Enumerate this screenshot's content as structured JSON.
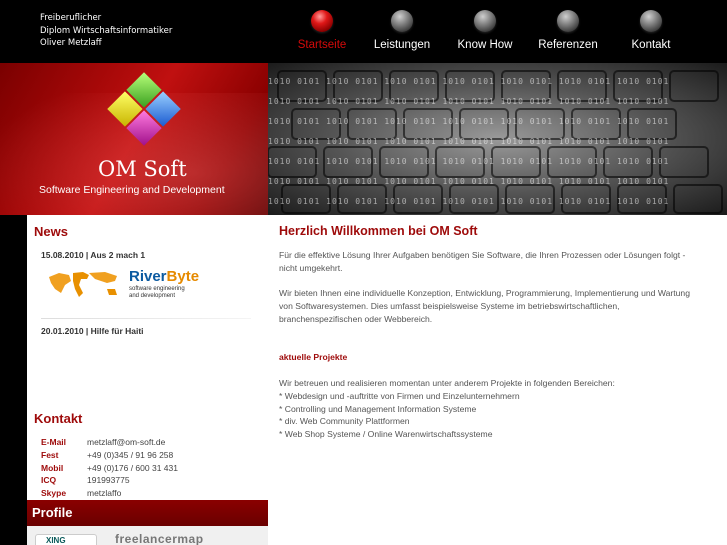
{
  "header": {
    "owner_lines": [
      "Freiberuflicher",
      "Diplom Wirtschaftsinformatiker",
      "Oliver Metzlaff"
    ],
    "nav": [
      {
        "label": "Startseite",
        "active": true
      },
      {
        "label": "Leistungen",
        "active": false
      },
      {
        "label": "Know How",
        "active": false
      },
      {
        "label": "Referenzen",
        "active": false
      },
      {
        "label": "Kontakt",
        "active": false
      }
    ]
  },
  "banner": {
    "brand": "OM Soft",
    "tagline": "Software Engineering and Development",
    "binary_text": "1010 0101 1010 0101 1010 0101 1010 0101 1010 0101 1010 0101 1010 0101"
  },
  "sidebar": {
    "news_heading": "News",
    "news": [
      {
        "date_title": "15.08.2010 | Aus 2 mach 1",
        "logo_name": "RiverByte",
        "logo_name_accent": "Byte",
        "logo_name_main": "River",
        "logo_sub_1": "software engineering",
        "logo_sub_2": "and development"
      },
      {
        "date_title": "20.01.2010 | Hilfe für Haiti"
      }
    ],
    "contact_heading": "Kontakt",
    "contact": [
      {
        "key": "E-Mail",
        "value": "metzlaff@om-soft.de"
      },
      {
        "key": "Fest",
        "value": "+49 (0)345 / 91 96 258"
      },
      {
        "key": "Mobil",
        "value": "+49 (0)176 / 600 31 431"
      },
      {
        "key": "ICQ",
        "value": "191993775"
      },
      {
        "key": "Skype",
        "value": "metzlaffo"
      }
    ],
    "profile_heading": "Profile",
    "profile_badges": {
      "xing": "XING",
      "freelancer": "freelancermap"
    }
  },
  "main": {
    "title": "Herzlich Willkommen bei OM Soft",
    "intro": "Für die effektive Lösung Ihrer Aufgaben benötigen Sie Software, die Ihren Prozessen oder Lösungen folgt - nicht umgekehrt.",
    "services": "Wir bieten Ihnen eine individuelle Konzeption, Entwicklung, Programmierung, Implementierung und Wartung von Softwaresystemen. Dies umfasst beispielsweise Systeme im betriebswirtschaftlichen, branchenspezifischen oder Webbereich.",
    "projects_heading": "aktuelle Projekte",
    "projects_intro": "Wir betreuen und realisieren momentan unter anderem Projekte in folgenden Bereichen:",
    "projects": [
      "* Webdesign und -auftritte von Firmen und Einzelunternehmern",
      "* Controlling und Management Information Systeme",
      "* div. Web Community Plattformen",
      "* Web Shop Systeme / Online Warenwirtschaftssysteme"
    ]
  },
  "colors": {
    "accent": "#9e0a0a",
    "active_nav": "#d40a0a",
    "banner_red": "#a50808"
  }
}
